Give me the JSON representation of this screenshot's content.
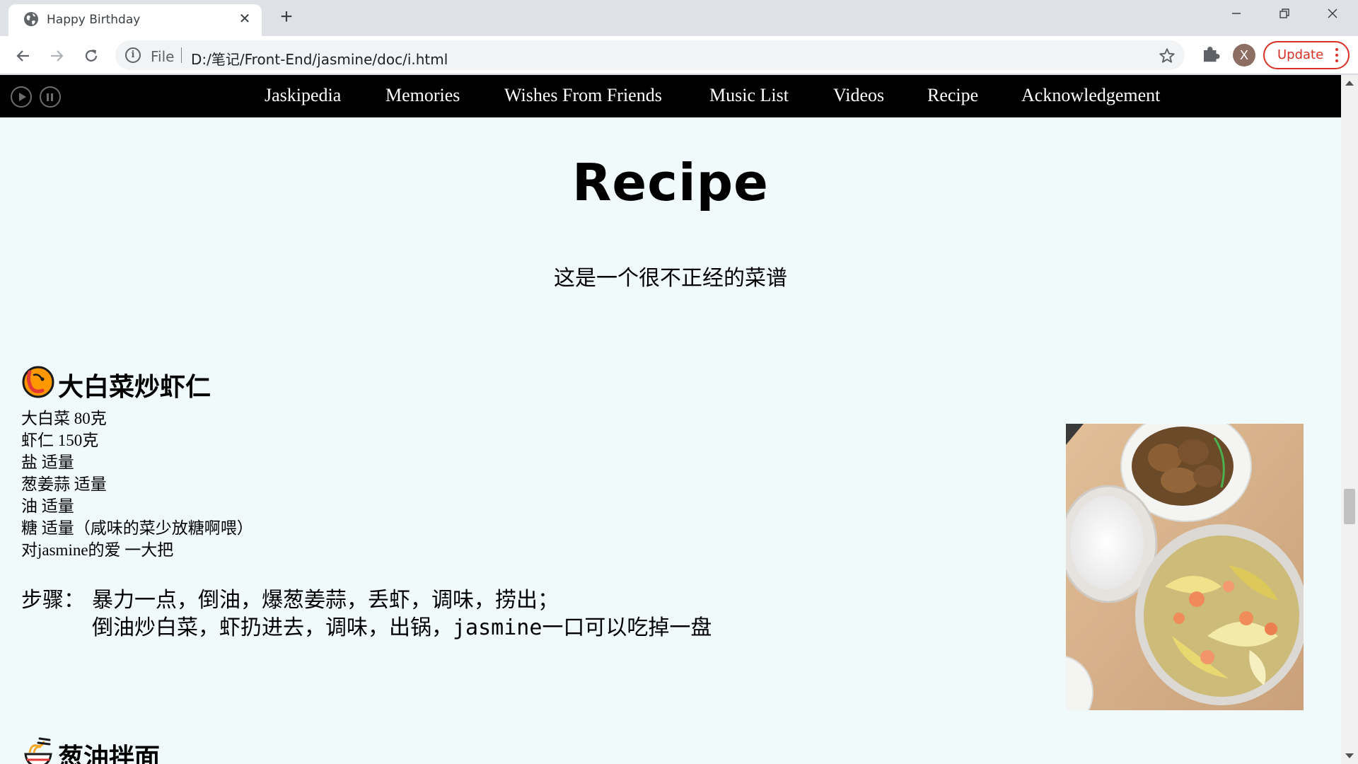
{
  "browser": {
    "tab_title": "Happy Birthday",
    "new_tab_symbol": "+",
    "close_symbol": "✕",
    "omnibox_scheme": "File",
    "omnibox_url": "D:/笔记/Front-End/jasmine/doc/i.html",
    "avatar_letter": "X",
    "update_label": "Update",
    "icons": [
      "globe-icon",
      "back-icon",
      "forward-icon",
      "reload-icon",
      "info-icon",
      "star-icon",
      "puzzle-icon",
      "minimize-icon",
      "restore-icon",
      "close-icon"
    ]
  },
  "site_nav": {
    "links": [
      "Jaskipedia",
      "Memories",
      "Wishes From Friends",
      "Music List",
      "Videos",
      "Recipe",
      "Acknowledgement"
    ],
    "player_icons": [
      "play-icon",
      "pause-icon"
    ]
  },
  "page": {
    "title": "Recipe",
    "subtitle": "这是一个很不正经的菜谱"
  },
  "dishes": [
    {
      "emoji": "shrimp-icon",
      "name": "大白菜炒虾仁",
      "ingredients": [
        "大白菜 80克",
        "虾仁 150克",
        "盐 适量",
        "葱姜蒜 适量",
        "油 适量",
        "糖 适量（咸味的菜少放糖啊喂）",
        "对jasmine的爱 一大把"
      ],
      "steps_label": "步骤：",
      "steps": [
        "暴力一点，倒油，爆葱姜蒜，丢虾，调味，捞出；",
        "倒油炒白菜，虾扔进去，调味，出锅，jasmine一口可以吃掉一盘"
      ]
    },
    {
      "emoji": "noodles-icon",
      "name": "葱油拌面"
    }
  ],
  "colors": {
    "page_bg": "#f0fafa",
    "nav_bg": "#000000",
    "update_red": "#d93025",
    "chrome_bg": "#dee1e6"
  }
}
